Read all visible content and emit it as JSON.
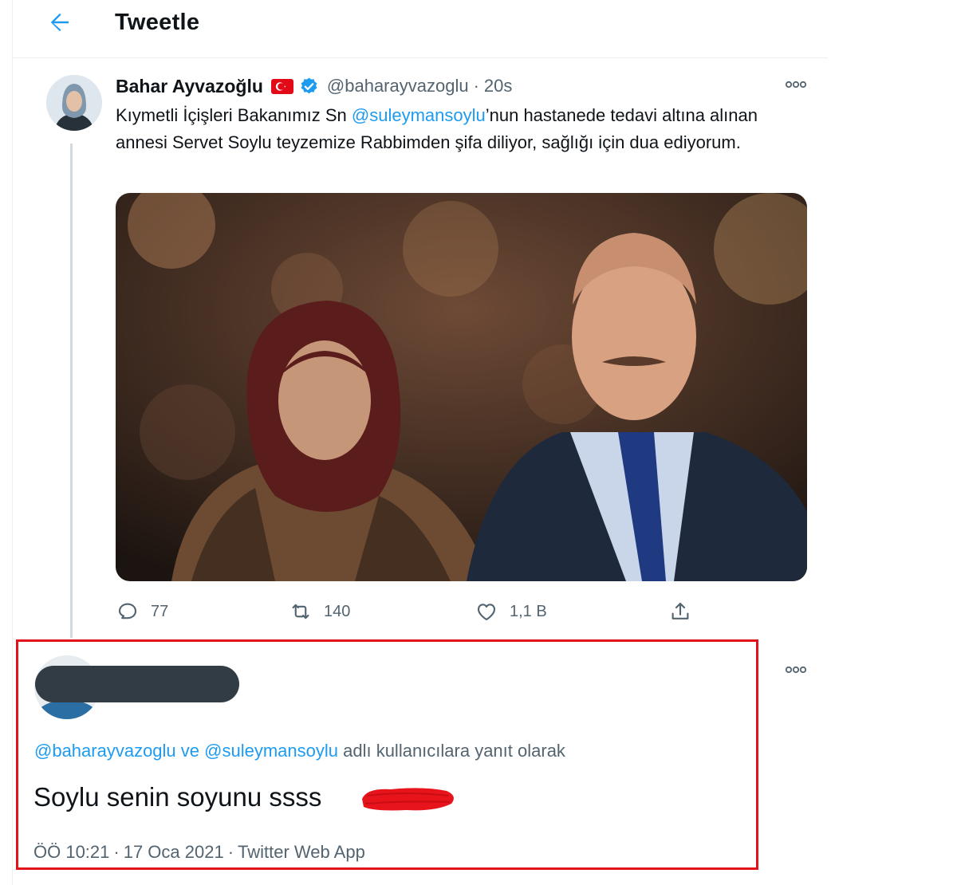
{
  "header": {
    "title": "Tweetle",
    "back_icon": "arrow-left-icon"
  },
  "tweet": {
    "author_name": "Bahar Ayvazoğlu",
    "handle": "@baharayvazoglu",
    "separator": "·",
    "time": "20s",
    "flag_icon": "turkey-flag-icon",
    "verified_icon": "verified-badge-icon",
    "text_before": "Kıymetli İçişleri Bakanımız Sn ",
    "mention": "@suleymansoylu",
    "text_after": "’nun hastanede tedavi altına alınan annesi Servet Soylu teyzemize Rabbimden şifa diliyor, sağlığı için dua ediyorum.",
    "actions": {
      "reply_count": "77",
      "retweet_count": "140",
      "like_count": "1,1 B"
    }
  },
  "reply": {
    "replying_mention_1": "@baharayvazoglu",
    "replying_connector": " ve ",
    "replying_mention_2": "@suleymansoylu",
    "replying_suffix": " adlı kullanıcılara yanıt olarak",
    "text": "Soylu senin soyunu ssss",
    "time": "ÖÖ 10:21",
    "date": "17 Oca 2021",
    "separator": "·",
    "source": "Twitter Web App"
  },
  "colors": {
    "accent": "#1d9bf0",
    "highlight_border": "#e1131a",
    "secondary_text": "#536471"
  }
}
